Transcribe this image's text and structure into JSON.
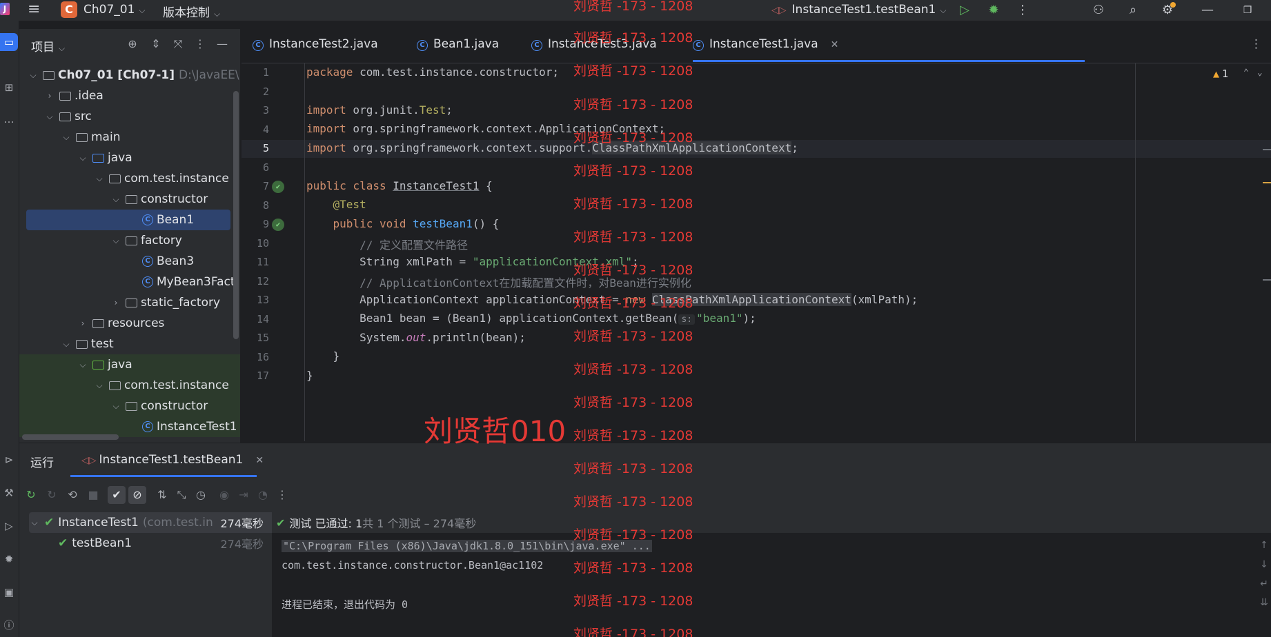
{
  "titlebar": {
    "project_letter": "C",
    "project_name": "Ch07_01",
    "vcs_label": "版本控制",
    "run_config": "InstanceTest1.testBean1"
  },
  "project_panel": {
    "title": "项目",
    "tree": [
      {
        "label": "Ch07_01 [Ch07-1]",
        "extra": "D:\\JavaEE\\",
        "depth": 0,
        "arrow": "open",
        "icon": "folder"
      },
      {
        "label": ".idea",
        "depth": 1,
        "arrow": "closed",
        "icon": "folder"
      },
      {
        "label": "src",
        "depth": 1,
        "arrow": "open",
        "icon": "folder"
      },
      {
        "label": "main",
        "depth": 2,
        "arrow": "open",
        "icon": "folder"
      },
      {
        "label": "java",
        "depth": 3,
        "arrow": "open",
        "icon": "folder-blue"
      },
      {
        "label": "com.test.instance",
        "depth": 4,
        "arrow": "open",
        "icon": "package"
      },
      {
        "label": "constructor",
        "depth": 5,
        "arrow": "open",
        "icon": "package"
      },
      {
        "label": "Bean1",
        "depth": 6,
        "arrow": "none",
        "icon": "class",
        "selected": true
      },
      {
        "label": "factory",
        "depth": 5,
        "arrow": "open",
        "icon": "package"
      },
      {
        "label": "Bean3",
        "depth": 6,
        "arrow": "none",
        "icon": "class"
      },
      {
        "label": "MyBean3Fact",
        "depth": 6,
        "arrow": "none",
        "icon": "class"
      },
      {
        "label": "static_factory",
        "depth": 5,
        "arrow": "closed",
        "icon": "package"
      },
      {
        "label": "resources",
        "depth": 3,
        "arrow": "closed",
        "icon": "folder-res"
      },
      {
        "label": "test",
        "depth": 2,
        "arrow": "open",
        "icon": "folder"
      },
      {
        "label": "java",
        "depth": 3,
        "arrow": "open",
        "icon": "folder-green",
        "test": true
      },
      {
        "label": "com.test.instance",
        "depth": 4,
        "arrow": "open",
        "icon": "package",
        "test": true
      },
      {
        "label": "constructor",
        "depth": 5,
        "arrow": "open",
        "icon": "package",
        "test": true
      },
      {
        "label": "InstanceTest1",
        "depth": 6,
        "arrow": "none",
        "icon": "class",
        "test": true
      }
    ]
  },
  "tabs": [
    {
      "label": "InstanceTest2.java"
    },
    {
      "label": "Bean1.java"
    },
    {
      "label": "InstanceTest3.java"
    },
    {
      "label": "InstanceTest1.java",
      "active": true
    }
  ],
  "editor": {
    "current_line": 5,
    "warning_count": "1",
    "line_numbers": [
      "1",
      "2",
      "3",
      "4",
      "5",
      "6",
      "7",
      "8",
      "9",
      "10",
      "11",
      "12",
      "13",
      "14",
      "15",
      "16",
      "17"
    ],
    "lines": {
      "l1_kw": "package",
      "l1_rest": " com.test.instance.constructor;",
      "l3_kw": "import",
      "l3_a": " org.junit.",
      "l3_b": "Test",
      "l3_c": ";",
      "l4_kw": "import",
      "l4_rest": " org.springframework.context.ApplicationContext;",
      "l5_kw": "import",
      "l5_a": " org.springframework.context.support.",
      "l5_b": "ClassPathXmlApplicationContext",
      "l5_c": ";",
      "l7_kw": "public class",
      "l7_sp": " ",
      "l7_name": "InstanceTest1",
      "l7_rest": " {",
      "l8_ann": "@Test",
      "l9_kw": "public void",
      "l9_sp": " ",
      "l9_fn": "testBean1",
      "l9_rest": "() {",
      "l10_cm": "// 定义配置文件路径",
      "l11_a": "String xmlPath = ",
      "l11_str": "\"applicationContext.xml\"",
      "l11_c": ";",
      "l12_cm": "// ApplicationContext在加载配置文件时，对Bean进行实例化",
      "l13_a": "ApplicationContext applicationContext = ",
      "l13_kw": "new",
      "l13_sp": " ",
      "l13_b": "ClassPathXmlApplicationContext",
      "l13_c": "(xmlPath);",
      "l14_a": "Bean1 bean = (Bean1) applicationContext.getBean(",
      "l14_hint": "s:",
      "l14_str": "\"bean1\"",
      "l14_c": ");",
      "l15_a": "System.",
      "l15_st": "out",
      "l15_c": ".println(bean);",
      "l16": "}",
      "l17": "}"
    }
  },
  "run_panel": {
    "title": "运行",
    "tab_label": "InstanceTest1.testBean1",
    "tests": [
      {
        "name": "InstanceTest1",
        "extra": "(com.test.in",
        "time": "274毫秒"
      },
      {
        "name": "testBean1",
        "time": "274毫秒"
      }
    ],
    "status": {
      "check": "✔",
      "label": "测试 已通过: 1",
      "detail": "共 1 个测试 – 274毫秒"
    },
    "console": [
      "\"C:\\Program Files (x86)\\Java\\jdk1.8.0_151\\bin\\java.exe\" ...",
      "com.test.instance.constructor.Bean1@ac1102",
      "",
      "进程已结束，退出代码为 0"
    ]
  },
  "watermark": {
    "repeat_text": "刘贤哲 -173 - 1208",
    "big_text": "刘贤哲010"
  }
}
